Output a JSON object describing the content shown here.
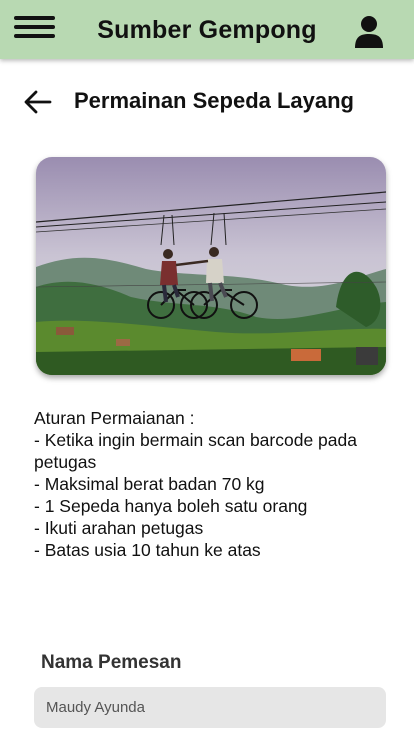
{
  "header": {
    "app_title": "Sumber Gempong",
    "menu_icon": "hamburger-menu-icon",
    "user_icon": "user-icon",
    "bg_color": "#b8d9b2"
  },
  "page": {
    "back_icon": "back-arrow-icon",
    "title": "Permainan Sepeda Layang"
  },
  "rules": {
    "heading": "Aturan Permaianan :",
    "items": [
      "- Ketika ingin bermain scan barcode pada petugas",
      "- Maksimal berat badan 70 kg",
      "- 1 Sepeda hanya boleh satu orang",
      "- Ikuti arahan petugas",
      "- Batas usia 10 tahun ke atas"
    ]
  },
  "form": {
    "name_label": "Nama Pemesan",
    "name_value": "Maudy Ayunda"
  }
}
